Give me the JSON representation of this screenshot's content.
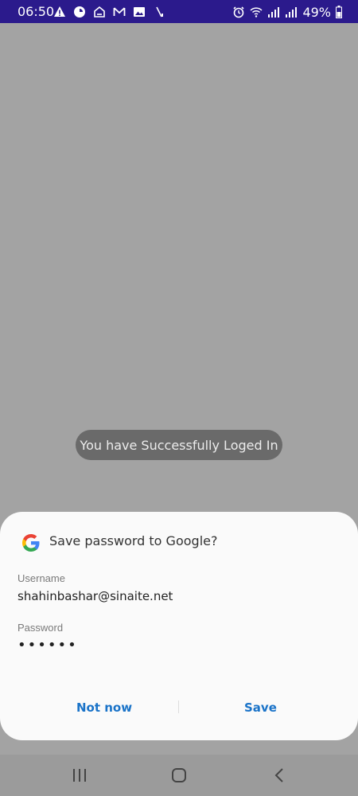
{
  "status_bar": {
    "time": "06:50",
    "battery_percent": "49%",
    "left_icons": [
      "alert-icon",
      "data-saver-icon",
      "shield-icon",
      "gmail-icon",
      "image-icon",
      "signal-slash-icon"
    ],
    "right_icons": [
      "alarm-icon",
      "wifi-icon",
      "signal-icon",
      "signal-icon",
      "battery-icon"
    ]
  },
  "toast": {
    "message": "You have Successfully Loged In"
  },
  "save_password_sheet": {
    "title": "Save password to Google?",
    "username_label": "Username",
    "username_value": "shahinbashar@sinaite.net",
    "password_label": "Password",
    "password_value": "••••••",
    "not_now_label": "Not now",
    "save_label": "Save"
  },
  "nav_bar": {
    "buttons": [
      "recents-icon",
      "home-icon",
      "back-icon"
    ]
  },
  "colors": {
    "status_bar_bg": "#2b1a8c",
    "scrim": "#a3a3a3",
    "accent": "#1a73c8"
  }
}
